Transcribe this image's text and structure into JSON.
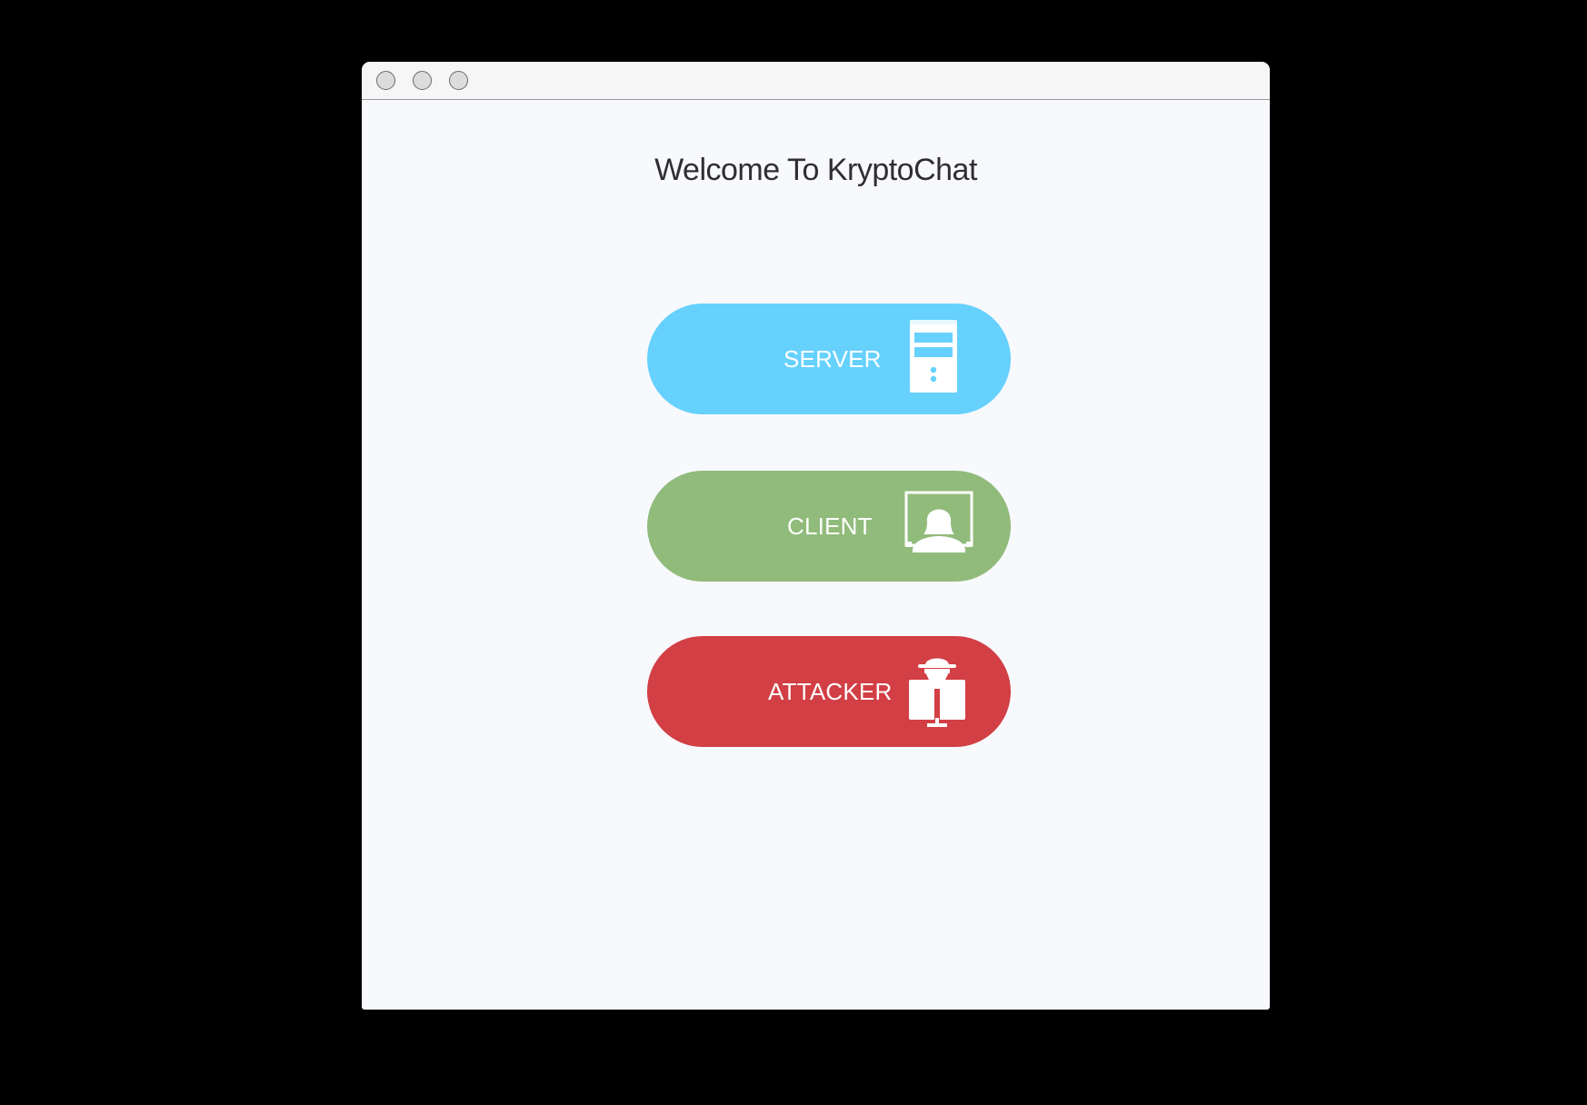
{
  "window": {
    "controls": [
      "close",
      "minimize",
      "zoom"
    ]
  },
  "main": {
    "title": "Welcome To KryptoChat"
  },
  "buttons": [
    {
      "label": "SERVER",
      "icon": "server-tower-icon",
      "color": "#66d1fd"
    },
    {
      "label": "CLIENT",
      "icon": "user-monitor-icon",
      "color": "#91bb7b"
    },
    {
      "label": "ATTACKER",
      "icon": "spy-computer-icon",
      "color": "#d23f45"
    }
  ]
}
